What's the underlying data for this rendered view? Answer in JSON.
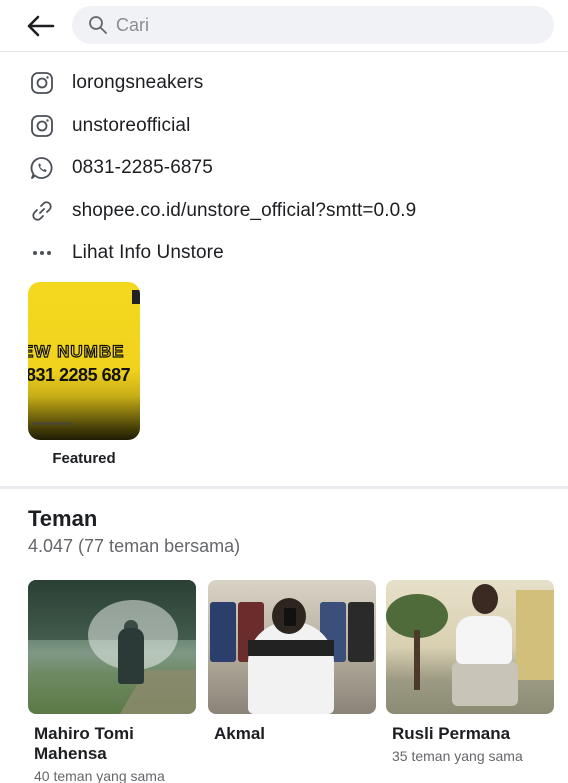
{
  "search": {
    "placeholder": "Cari"
  },
  "info": [
    {
      "icon": "instagram-icon",
      "text": "lorongsneakers"
    },
    {
      "icon": "instagram-icon",
      "text": "unstoreofficial"
    },
    {
      "icon": "whatsapp-icon",
      "text": "0831-2285-6875"
    },
    {
      "icon": "link-icon",
      "text": "shopee.co.id/unstore_official?smtt=0.0.9"
    },
    {
      "icon": "more-dots-icon",
      "text": "Lihat Info Unstore"
    }
  ],
  "featured": {
    "label": "Featured",
    "card_line1": "EW NUMBE",
    "card_line2": "831 2285 687"
  },
  "friends": {
    "title": "Teman",
    "count": "4.047 (77 teman bersama)",
    "items": [
      {
        "name": "Mahiro Tomi Mahensa",
        "mutual": "40 teman yang sama"
      },
      {
        "name": "Akmal",
        "mutual": ""
      },
      {
        "name": "Rusli Permana",
        "mutual": "35 teman yang sama"
      }
    ]
  },
  "colors": {
    "text_primary": "#1c1e21",
    "text_secondary": "#65676b",
    "search_bg": "#f0f2f5",
    "featured_yellow": "#f4d81f"
  }
}
